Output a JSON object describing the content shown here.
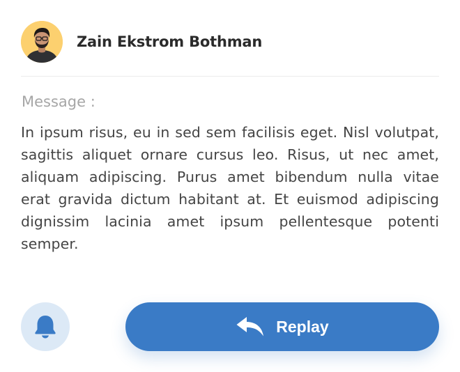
{
  "sender": {
    "name": "Zain Ekstrom Bothman",
    "avatar": "avatar-photo"
  },
  "message": {
    "label": "Message :",
    "body": "In ipsum risus, eu in sed sem facilisis eget. Nisl volutpat, sagittis aliquet ornare cursus leo. Risus, ut nec amet, aliquam adipiscing. Purus amet bibendum nulla vitae erat gravida dictum habitant at. Et euismod adipiscing dignissim lacinia amet ipsum pellentesque potenti semper."
  },
  "actions": {
    "notify_icon": "bell-icon",
    "reply_icon": "reply-arrow-icon",
    "reply_label": "Replay"
  },
  "colors": {
    "accent": "#3a7bc6",
    "bell_background": "#dce9f6",
    "avatar_background": "#fcd06f",
    "text": "#444444",
    "muted_text": "#a6a6a6"
  }
}
